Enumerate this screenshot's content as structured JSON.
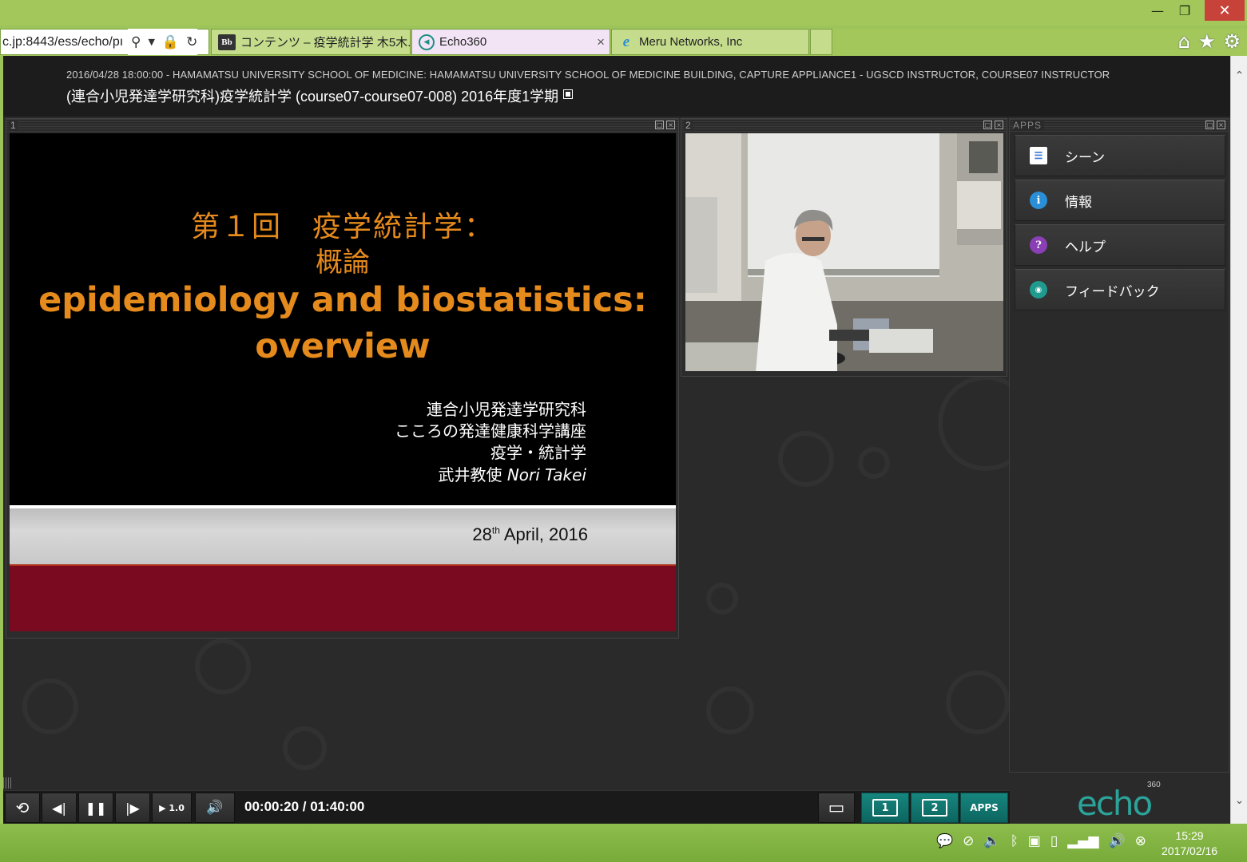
{
  "browser": {
    "url_fragment": "c.jp:8443/ess/echo/pı",
    "tabs": [
      {
        "icon": "blackboard-icon",
        "icon_text": "Bb",
        "label": "コンテンツ – 疫学統計学 木5木..."
      },
      {
        "icon": "echo360-icon",
        "label": "Echo360",
        "close": "×"
      },
      {
        "icon": "ie-icon",
        "label": "Meru Networks, Inc"
      }
    ],
    "window_controls": {
      "minimize": "—",
      "restore": "❐",
      "close": "✕"
    },
    "toolbar_icons": {
      "home": "⌂",
      "favorites": "★",
      "settings": "⚙"
    }
  },
  "header": {
    "meta": "2016/04/28 18:00:00 - HAMAMATSU UNIVERSITY SCHOOL OF MEDICINE: HAMAMATSU UNIVERSITY SCHOOL OF MEDICINE BUILDING, CAPTURE APPLIANCE1 - UGSCD INSTRUCTOR, COURSE07 INSTRUCTOR",
    "title": "(連合小児発達学研究科)疫学統計学 (course07-course07-008) 2016年度1学期"
  },
  "panel1": {
    "number": "1",
    "slide": {
      "line1": "第１回　疫学統計学：",
      "line2": "概論",
      "line3": "epidemiology and biostatistics:",
      "line4": "overview",
      "affiliation": [
        "連合小児発達学研究科",
        "こころの発達健康科学講座",
        "疫学・統計学"
      ],
      "author_jp": "武井教使",
      "author_en": "Nori Takei",
      "date_day": "28",
      "date_suffix": "th",
      "date_rest": " April, 2016"
    }
  },
  "panel2": {
    "number": "2"
  },
  "apps": {
    "label": "APPS",
    "items": [
      {
        "icon": "scenes-icon",
        "label": "シーン",
        "color": "#3a7bd5"
      },
      {
        "icon": "info-icon",
        "label": "情報",
        "color": "#2a8fd6"
      },
      {
        "icon": "help-icon",
        "label": "ヘルプ",
        "color": "#8a3fb5"
      },
      {
        "icon": "feedback-icon",
        "label": "フィードバック",
        "color": "#1f9a8e"
      }
    ]
  },
  "controls": {
    "replay": "⟲",
    "step_back": "◀|",
    "pause": "❚❚",
    "step_forward": "|▶",
    "speed": "▶ 1.0",
    "volume": "🔊",
    "time": "00:00:20 / 01:40:00",
    "layout_label": "▭",
    "source1": "1",
    "source2": "2",
    "apps": "APPS"
  },
  "brand": {
    "logo": "echo",
    "logo_sup": "360",
    "accent": "#1f8a82"
  },
  "taskbar": {
    "time": "15:29",
    "date": "2017/02/16"
  }
}
